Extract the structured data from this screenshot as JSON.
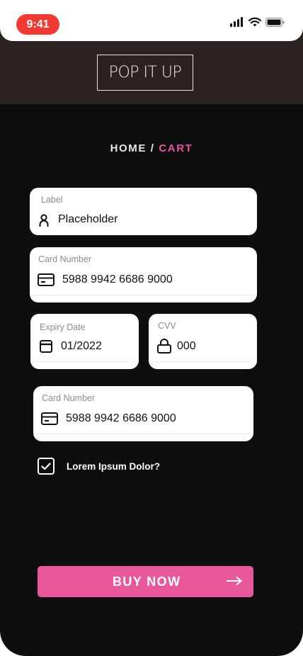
{
  "status_bar": {
    "time": "9:41",
    "icons": [
      "cellular-signal-icon",
      "wifi-icon",
      "battery-icon"
    ]
  },
  "brand": {
    "logo_text": "POP IT UP"
  },
  "breadcrumb": {
    "home": "HOME",
    "separator": "/",
    "current": "CART"
  },
  "form": {
    "label_field": {
      "label": "Label",
      "value": "Placeholder",
      "icon": "person-icon"
    },
    "card_number": {
      "label": "Card Number",
      "value": "5988 9942 6686 9000",
      "icon": "credit-card-icon"
    },
    "expiry": {
      "label": "Expiry Date",
      "value": "01/2022",
      "icon": "calendar-icon"
    },
    "cvv": {
      "label": "CVV",
      "value": "000",
      "icon": "lock-icon"
    },
    "card_number_2": {
      "label": "Card Number",
      "value": "5988 9942 6686 9000",
      "icon": "credit-card-icon"
    },
    "agree_checkbox": {
      "label": "Lorem Ipsum Dolor?",
      "checked": true
    }
  },
  "cta": {
    "label": "BUY NOW",
    "icon": "arrow-right-icon"
  },
  "colors": {
    "accent": "#e8589a",
    "time_pill": "#ef3b33",
    "background": "#0f0e0e",
    "header": "#2a2322"
  }
}
